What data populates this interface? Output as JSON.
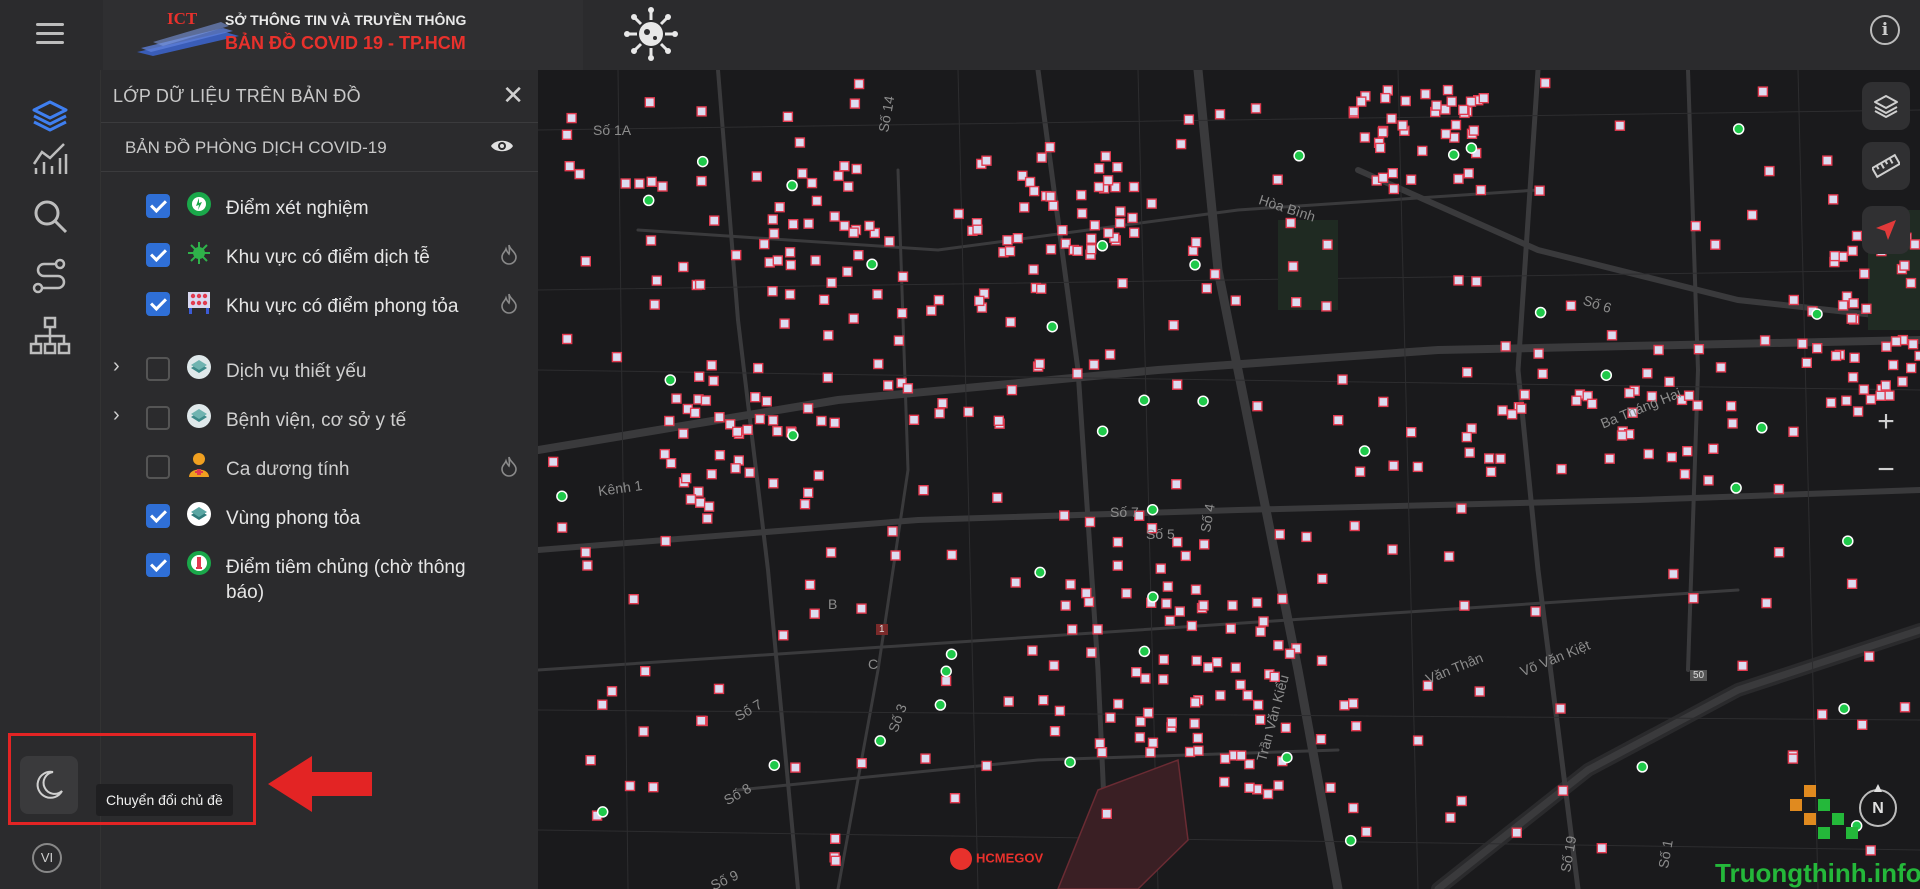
{
  "header": {
    "org_name": "SỞ THÔNG TIN VÀ TRUYỀN THÔNG",
    "map_title": "BẢN ĐỒ  COVID 19 - TP.HCM",
    "logo_text": "ICT",
    "info_icon": "info-icon",
    "menu_icon": "hamburger-menu-icon"
  },
  "rail": {
    "items": [
      {
        "icon": "layers-icon"
      },
      {
        "icon": "chart-icon"
      },
      {
        "icon": "search-icon"
      },
      {
        "icon": "route-icon"
      },
      {
        "icon": "sitemap-icon"
      }
    ]
  },
  "panel": {
    "title": "LỚP DỮ LIỆU TRÊN BẢN ĐỒ",
    "close_icon": "close-icon",
    "subtitle": "BẢN ĐỒ PHÒNG DỊCH COVID-19",
    "layers": [
      {
        "label": "Điểm xét nghiệm",
        "checked": true,
        "expandable": false,
        "heatmap": false
      },
      {
        "label": "Khu vực có điểm dịch tễ",
        "checked": true,
        "expandable": false,
        "heatmap": true
      },
      {
        "label": "Khu vực có điểm phong tỏa",
        "checked": true,
        "expandable": false,
        "heatmap": true
      },
      {
        "label": "Dịch vụ thiết yếu",
        "checked": false,
        "expandable": true,
        "heatmap": false
      },
      {
        "label": "Bệnh viện, cơ sở y tế",
        "checked": false,
        "expandable": true,
        "heatmap": false
      },
      {
        "label": "Ca dương tính",
        "checked": false,
        "expandable": false,
        "heatmap": true
      },
      {
        "label": "Vùng phong tỏa",
        "checked": true,
        "expandable": false,
        "heatmap": false
      },
      {
        "label": "Điểm tiêm chủng (chờ thông báo)",
        "checked": true,
        "expandable": false,
        "heatmap": false
      }
    ]
  },
  "theme": {
    "tooltip": "Chuyển đổi chủ đề",
    "icon": "moon-icon"
  },
  "language": "VI",
  "map": {
    "streets": [
      "Số 1A",
      "Hòa Bình",
      "Số 14",
      "Số 6",
      "Ba Tháng Hai",
      "Kênh 1",
      "Số 7",
      "Số 5",
      "Số 4",
      "B",
      "C",
      "Số 3",
      "Số 7",
      "Số 8",
      "Trần Văn Kiểu",
      "Văn Thân",
      "Võ Văn Kiệt",
      "Số 9",
      "Số 19",
      "Số 1",
      "1",
      "50"
    ],
    "watermark": "HCMEGOV",
    "brand": "Truongthinh.info",
    "compass_label": "N",
    "colors": {
      "marker_red": "#e23a4f",
      "marker_green": "#1fc94a",
      "checkbox": "#2f6fd6",
      "highlight": "#e32424"
    }
  }
}
